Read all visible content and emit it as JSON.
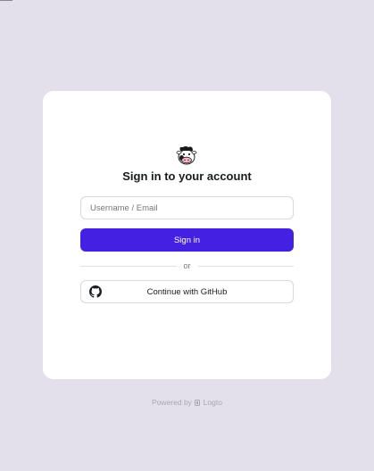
{
  "app": {
    "title": "Sign in to your account"
  },
  "form": {
    "identifier_placeholder": "Username / Email",
    "identifier_value": "",
    "submit_label": "Sign in",
    "divider_text": "or",
    "social_label": "Continue with GitHub",
    "social_icon": "github-icon"
  },
  "footer": {
    "powered_by": "Powered by",
    "brand": "Logto"
  },
  "colors": {
    "background": "#e3e0ec",
    "card": "#ffffff",
    "primary": "#4420e2",
    "text": "#191c1d",
    "muted": "#a9a7b2"
  }
}
